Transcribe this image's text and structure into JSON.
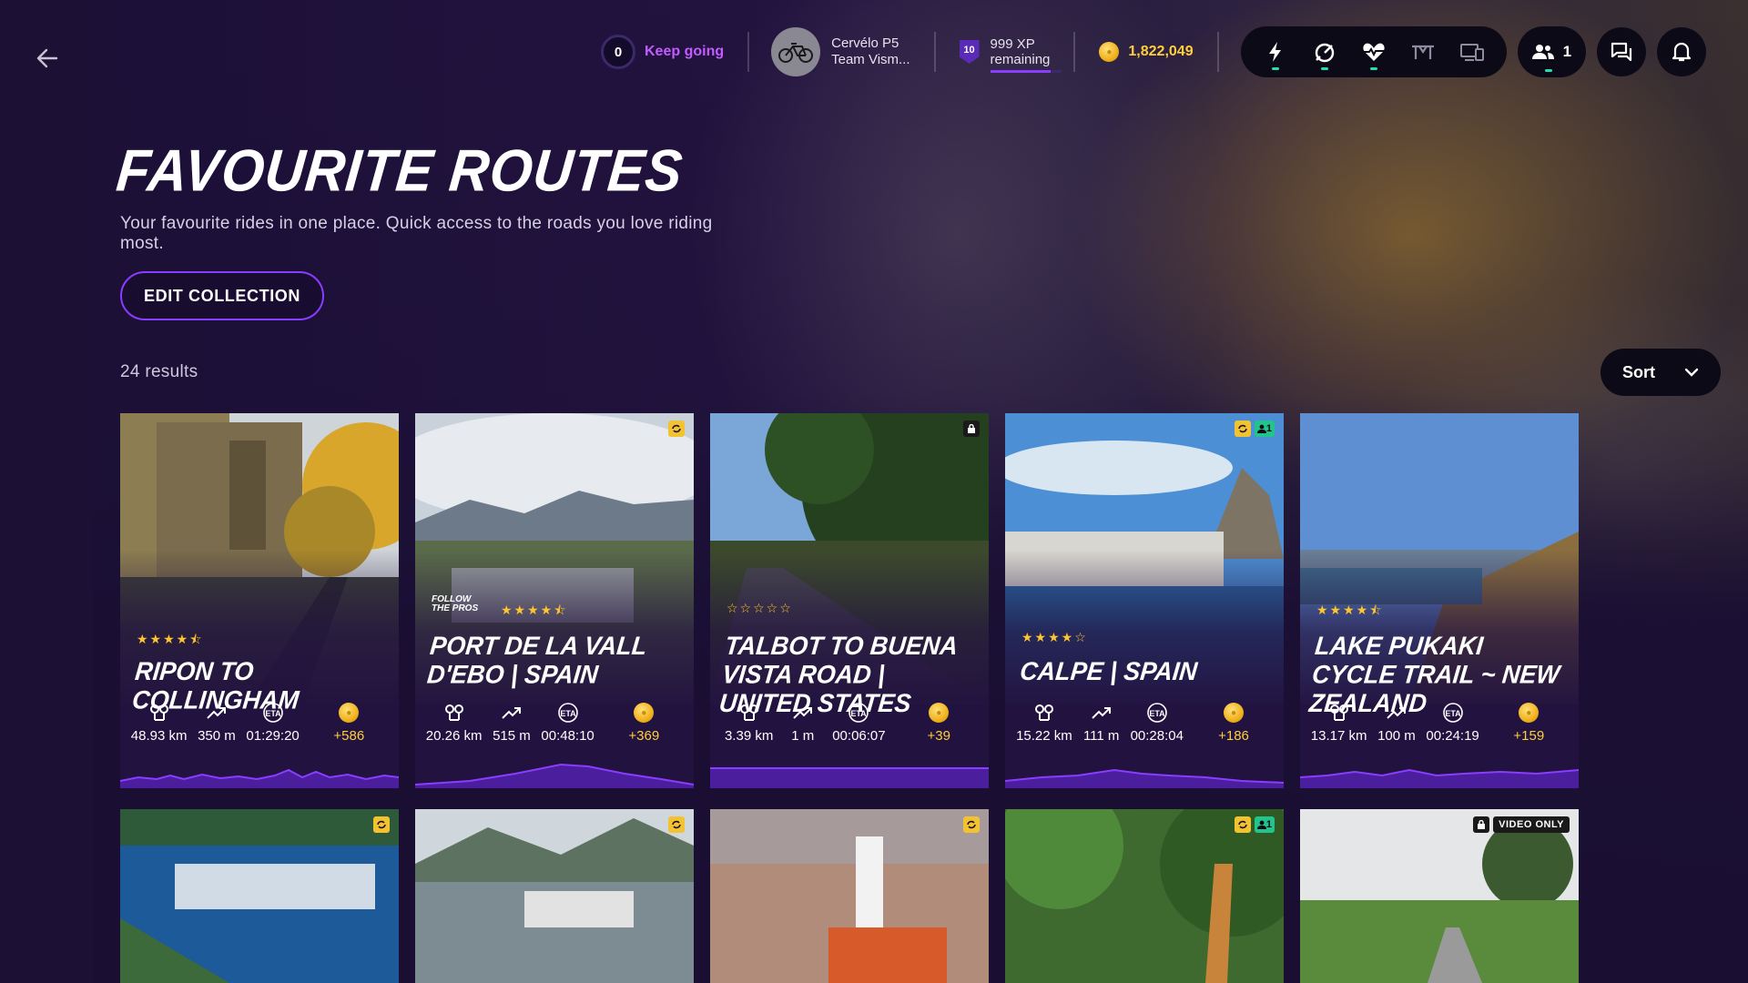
{
  "header": {
    "goal": {
      "value": "0",
      "label": "Keep going"
    },
    "bike": {
      "line1": "Cervélo P5",
      "line2": "Team Vism..."
    },
    "xp": {
      "level": "10",
      "line1": "999 XP",
      "line2": "remaining",
      "progress": 0.85
    },
    "coins": "1,822,049",
    "users_count": "1",
    "icons": [
      "lightning-icon",
      "speedometer-icon",
      "heart-rate-icon",
      "trainer-icon",
      "devices-icon"
    ]
  },
  "page": {
    "title": "FAVOURITE ROUTES",
    "subtitle": "Your favourite rides in one place. Quick access to the roads you love riding most.",
    "edit_label": "EDIT COLLECTION",
    "results": "24 results",
    "sort_label": "Sort"
  },
  "routes": [
    {
      "name": "RIPON TO COLLINGHAM",
      "rating": "★★★★⯪",
      "distance": "48.93 km",
      "elevation": "350 m",
      "eta": "01:29:20",
      "xp": "+586",
      "badges": []
    },
    {
      "name": "PORT DE LA VALL D'EBO | SPAIN",
      "rating": "★★★★⯪",
      "distance": "20.26 km",
      "elevation": "515 m",
      "eta": "00:48:10",
      "xp": "+369",
      "follow_pros": "FOLLOW THE PROS",
      "badges": [
        "y"
      ]
    },
    {
      "name": "TALBOT TO BUENA VISTA ROAD | UNITED STATES",
      "rating": "☆☆☆☆☆",
      "distance": "3.39 km",
      "elevation": "1 m",
      "eta": "00:06:07",
      "xp": "+39",
      "badges": [
        "lock"
      ]
    },
    {
      "name": "CALPE | SPAIN",
      "rating": "★★★★☆",
      "distance": "15.22 km",
      "elevation": "111 m",
      "eta": "00:28:04",
      "xp": "+186",
      "badges": [
        "y",
        "g"
      ],
      "users": "1"
    },
    {
      "name": "LAKE PUKAKI CYCLE TRAIL ~ NEW ZEALAND",
      "rating": "★★★★⯪",
      "distance": "13.17 km",
      "elevation": "100 m",
      "eta": "00:24:19",
      "xp": "+159",
      "badges": []
    }
  ],
  "row2_badges": {
    "card7_users": "1",
    "video_only": "VIDEO ONLY"
  },
  "stat_labels": {
    "eta": "ETA"
  }
}
